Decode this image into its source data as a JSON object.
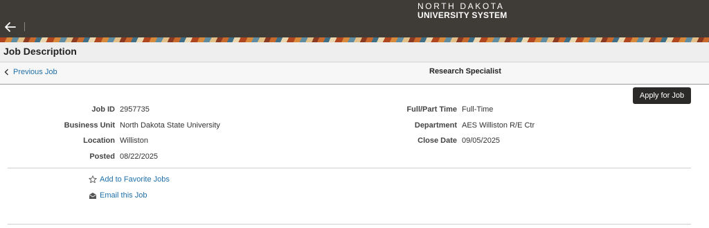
{
  "header": {
    "logo_line1": "NORTH DAKOTA",
    "logo_line2": "UNIVERSITY SYSTEM",
    "back_icon": "arrow-left-icon"
  },
  "titlebar": {
    "title": "Job Description"
  },
  "subheader": {
    "previous_label": "Previous Job",
    "previous_icon": "chevron-left-icon",
    "job_title": "Research Specialist"
  },
  "actions": {
    "apply_label": "Apply for Job"
  },
  "details": {
    "left": [
      {
        "label": "Job ID",
        "value": "2957735"
      },
      {
        "label": "Business Unit",
        "value": "North Dakota State University"
      },
      {
        "label": "Location",
        "value": "Williston"
      },
      {
        "label": "Posted",
        "value": "08/22/2025"
      }
    ],
    "right": [
      {
        "label": "Full/Part Time",
        "value": "Full-Time"
      },
      {
        "label": "Department",
        "value": "AES Williston R/E Ctr"
      },
      {
        "label": "Close Date",
        "value": "09/05/2025"
      }
    ]
  },
  "links": {
    "favorite_label": "Add to Favorite Jobs",
    "favorite_icon": "star-icon",
    "email_label": "Email this Job",
    "email_icon": "envelope-icon"
  },
  "colors": {
    "header_bg": "#3f3b37",
    "link": "#1f6fa8",
    "button_bg": "#2c2a29",
    "titlebar_bg": "#eeeeee"
  }
}
